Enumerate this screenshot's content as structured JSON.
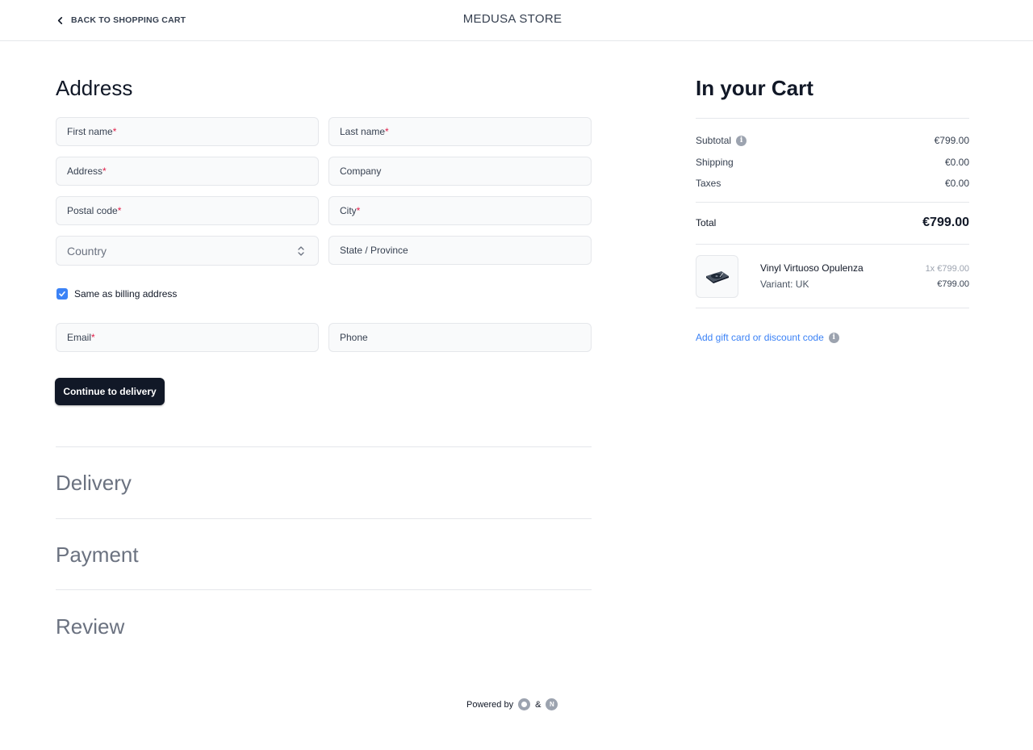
{
  "header": {
    "back_label": "BACK TO SHOPPING CART",
    "store_name": "MEDUSA STORE"
  },
  "address": {
    "title": "Address",
    "fields": {
      "first_name": "First name",
      "last_name": "Last name",
      "address": "Address",
      "company": "Company",
      "postal_code": "Postal code",
      "city": "City",
      "country": "Country",
      "state": "State / Province",
      "email": "Email",
      "phone": "Phone"
    },
    "required_marker": "*",
    "same_as_billing_label": "Same as billing address",
    "same_as_billing_checked": true,
    "continue_label": "Continue to delivery"
  },
  "steps": {
    "delivery": "Delivery",
    "payment": "Payment",
    "review": "Review"
  },
  "cart": {
    "title": "In your Cart",
    "subtotal_label": "Subtotal",
    "subtotal_value": "€799.00",
    "shipping_label": "Shipping",
    "shipping_value": "€0.00",
    "taxes_label": "Taxes",
    "taxes_value": "€0.00",
    "total_label": "Total",
    "total_value": "€799.00",
    "items": [
      {
        "name": "Vinyl Virtuoso Opulenza",
        "variant": "Variant: UK",
        "qty_price": "1x €799.00",
        "price": "€799.00"
      }
    ],
    "gift_label": "Add gift card or discount code"
  },
  "footer": {
    "powered_by": "Powered by",
    "ampersand": "&",
    "logo_n": "N"
  },
  "colors": {
    "accent": "#3b82f6",
    "button_bg": "#111827",
    "required": "#e11d48"
  }
}
